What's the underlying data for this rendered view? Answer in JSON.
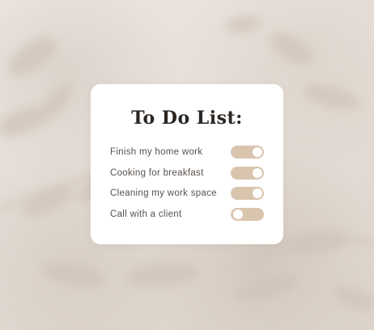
{
  "title": "To Do List:",
  "colors": {
    "card_background": "#ffffff",
    "toggle_track": "#d9c4ae",
    "toggle_knob": "#ffffff",
    "title_text": "#2b2622",
    "label_text": "#58514c",
    "page_background": "#e7e0da"
  },
  "tasks": [
    {
      "label": "Finish my home work",
      "checked": true
    },
    {
      "label": "Cooking for breakfast",
      "checked": true
    },
    {
      "label": "Cleaning my work space",
      "checked": true
    },
    {
      "label": "Call with a client",
      "checked": false
    }
  ]
}
